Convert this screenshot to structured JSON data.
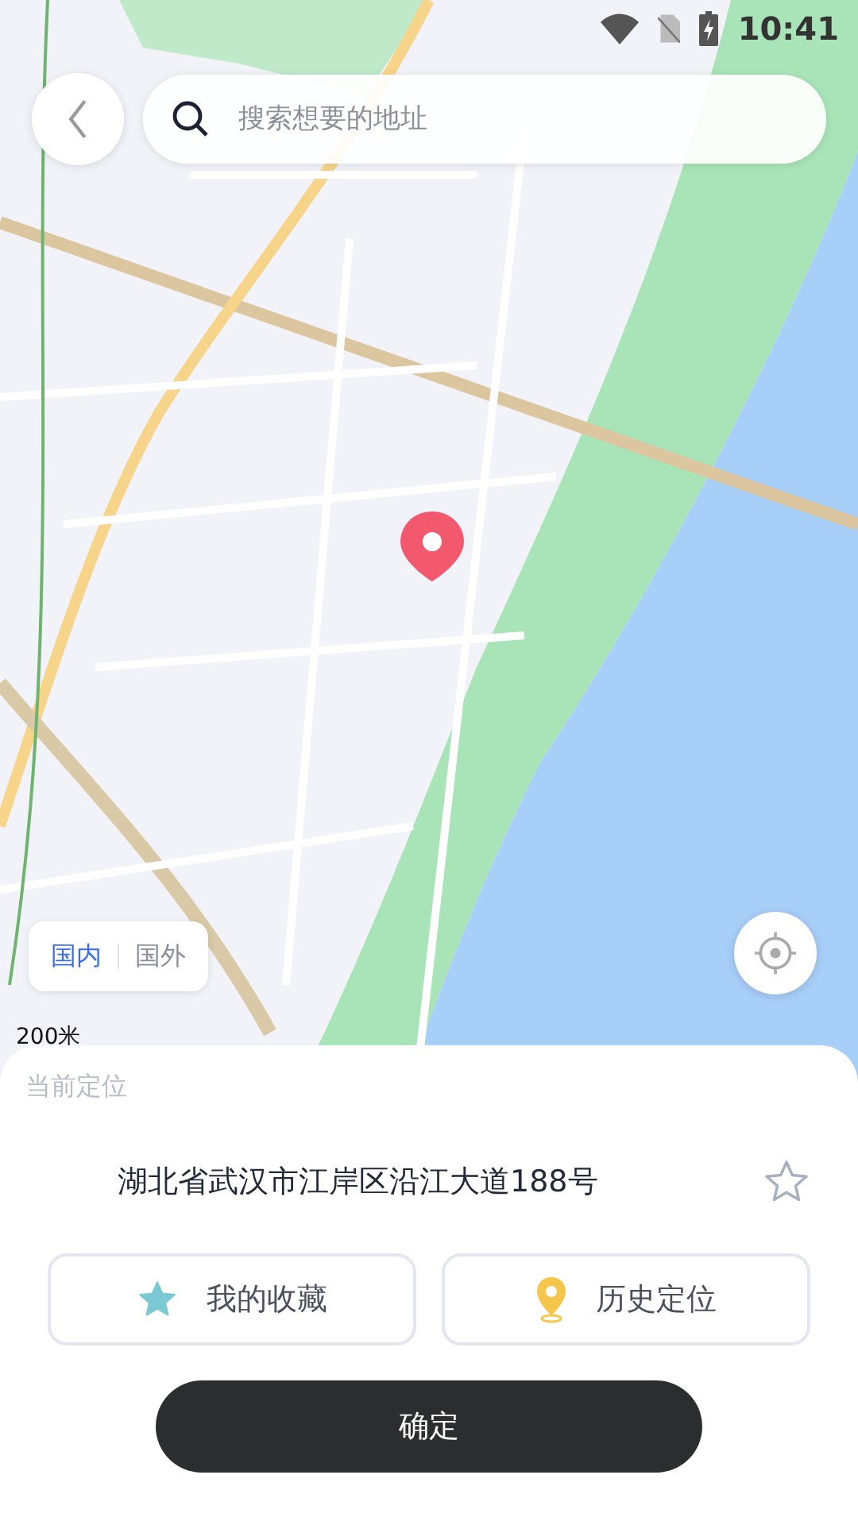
{
  "status_bar": {
    "time": "10:41"
  },
  "search": {
    "placeholder": "搜索想要的地址"
  },
  "region_tabs": [
    {
      "label": "国内",
      "selected": true
    },
    {
      "label": "国外",
      "selected": false
    }
  ],
  "map": {
    "scale": "200米"
  },
  "current_location": {
    "label": "当前定位",
    "address": "湖北省武汉市江岸区沿江大道188号",
    "favorited": false
  },
  "shortcuts": [
    {
      "kind": "favorites",
      "label": "我的收藏"
    },
    {
      "kind": "history",
      "label": "历史定位"
    }
  ],
  "confirm_button": "确定"
}
